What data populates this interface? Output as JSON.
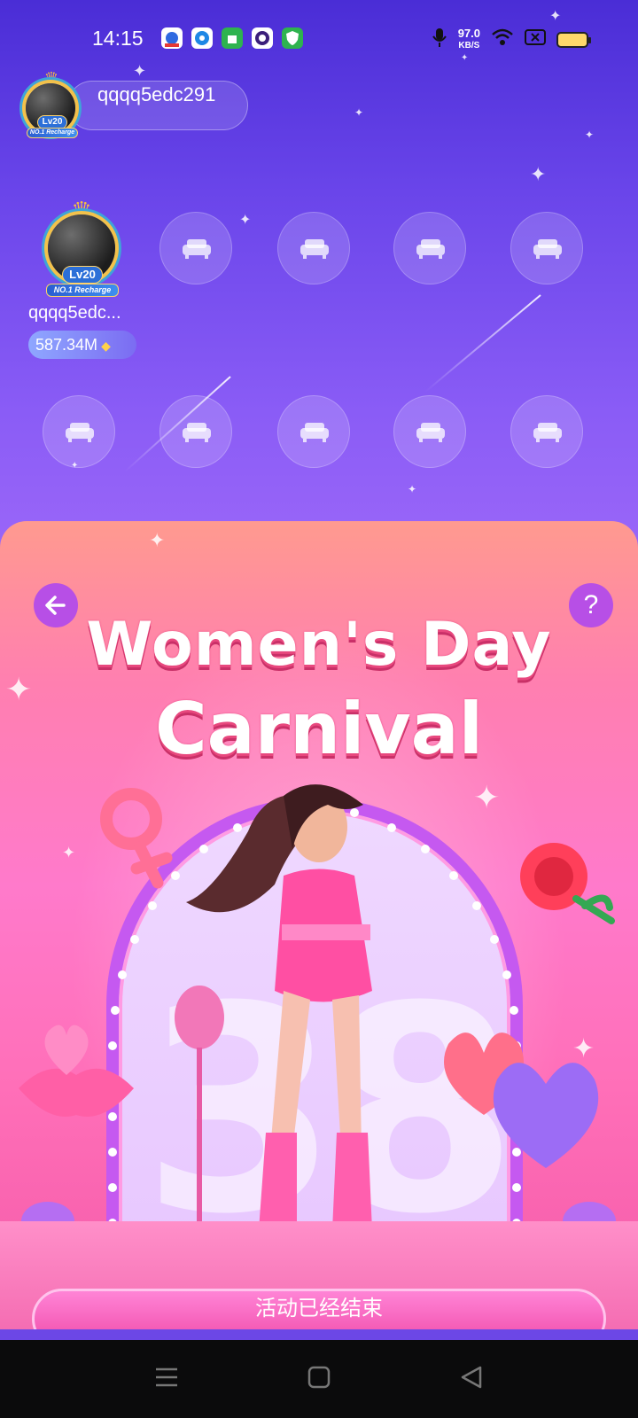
{
  "status_bar": {
    "time": "14:15",
    "net_speed_value": "97.0",
    "net_speed_unit": "KB/S",
    "notification_icons": [
      "baidu-icon",
      "app-dot-icon",
      "shopping-bag-icon",
      "camera-icon",
      "shield-icon"
    ],
    "right_icons": [
      "microphone-icon",
      "wifi-icon",
      "sim-blocked-icon",
      "battery-icon"
    ]
  },
  "room": {
    "host": {
      "name": "qqqq5edc291",
      "level": "Lv20",
      "badge": "NO.1 Recharge"
    },
    "seats": [
      {
        "occupied": true,
        "name": "qqqq5edc...",
        "level": "Lv20",
        "badge": "NO.1 Recharge",
        "coins": "587.34M"
      },
      {
        "occupied": false,
        "icon": "sofa-icon"
      },
      {
        "occupied": false,
        "icon": "sofa-icon"
      },
      {
        "occupied": false,
        "icon": "sofa-icon"
      },
      {
        "occupied": false,
        "icon": "sofa-icon"
      },
      {
        "occupied": false,
        "icon": "sofa-icon"
      },
      {
        "occupied": false,
        "icon": "sofa-icon"
      },
      {
        "occupied": false,
        "icon": "sofa-icon"
      },
      {
        "occupied": false,
        "icon": "sofa-icon"
      },
      {
        "occupied": false,
        "icon": "sofa-icon"
      }
    ]
  },
  "event": {
    "title_line1": "Women's Day",
    "title_line2": "Carnival",
    "stage_number": "38",
    "back_icon": "arrow-left-icon",
    "help_label": "?",
    "end_button_label": "活动已经结束"
  },
  "nav_bar": {
    "buttons": [
      "menu-icon",
      "home-square-icon",
      "back-triangle-icon"
    ]
  },
  "colors": {
    "room_top": "#4a2dd6",
    "room_bottom": "#9a66f8",
    "panel_pink": "#ff7acb",
    "title_shadow": "#e8487e",
    "button_purple": "#b74fe6"
  }
}
